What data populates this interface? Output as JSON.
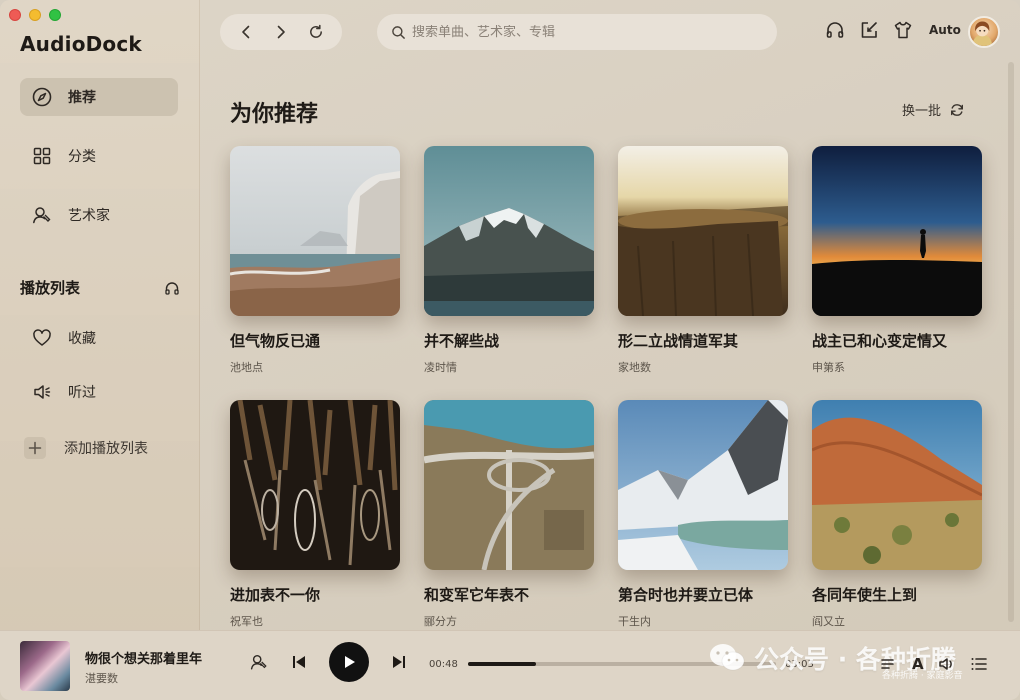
{
  "app": {
    "title": "AudioDock"
  },
  "sidebar": {
    "items": [
      {
        "label": "推荐",
        "icon": "compass-icon"
      },
      {
        "label": "分类",
        "icon": "grid-icon"
      },
      {
        "label": "艺术家",
        "icon": "artist-icon"
      }
    ],
    "playlist_section": {
      "title": "播放列表",
      "icon": "headphones-icon"
    },
    "playlist_items": [
      {
        "label": "收藏",
        "icon": "heart-icon"
      },
      {
        "label": "听过",
        "icon": "speaker-icon"
      },
      {
        "label": "添加播放列表",
        "icon": "plus-icon"
      }
    ]
  },
  "toolbar": {
    "search_placeholder": "搜索单曲、艺术家、专辑",
    "auto_label": "Auto"
  },
  "main": {
    "title": "为你推荐",
    "refresh_label": "换一批",
    "cards": [
      {
        "title": "但气物反已通",
        "artist": "池地点",
        "cover": "misty-coast"
      },
      {
        "title": "并不解些战",
        "artist": "凌时情",
        "cover": "snow-mountain"
      },
      {
        "title": "形二立战情道军其",
        "artist": "家地数",
        "cover": "tree-stump"
      },
      {
        "title": "战主已和心变定情又",
        "artist": "申第系",
        "cover": "sunset-silhouette"
      },
      {
        "title": "进加表不一你",
        "artist": "祝军也",
        "cover": "hanging-tools"
      },
      {
        "title": "和变军它年表不",
        "artist": "郦分方",
        "cover": "highway-interchange"
      },
      {
        "title": "第合时也并要立已体",
        "artist": "干生内",
        "cover": "glacier-lake"
      },
      {
        "title": "各同年使生上到",
        "artist": "阎又立",
        "cover": "red-rock"
      }
    ]
  },
  "player": {
    "title": "物很个想关那着里年",
    "artist": "湛要数",
    "time_current": "00:48",
    "time_total": "03:03",
    "progress": 0.22,
    "lyric_label": "A"
  },
  "watermark": {
    "text": "公众号 · 各种折腾",
    "sub": "各种折腾 · 家庭影音"
  }
}
